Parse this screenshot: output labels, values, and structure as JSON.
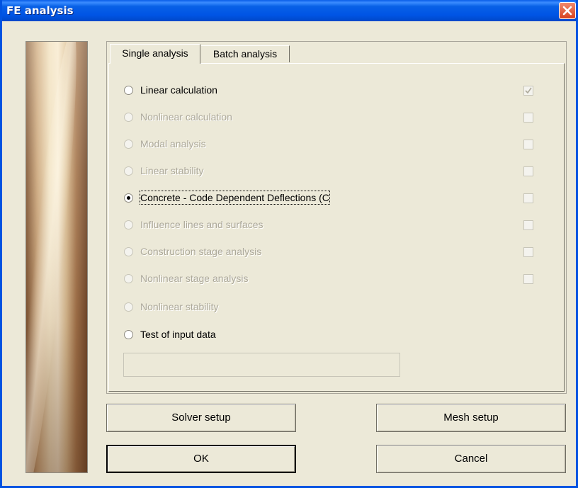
{
  "window": {
    "title": "FE analysis"
  },
  "tabs": [
    {
      "label": "Single analysis",
      "active": true
    },
    {
      "label": "Batch analysis",
      "active": false
    }
  ],
  "options": [
    {
      "label": "Linear calculation",
      "enabled": true,
      "selected": false,
      "checkbox": "checked"
    },
    {
      "label": "Nonlinear calculation",
      "enabled": false,
      "selected": false,
      "checkbox": "unchecked"
    },
    {
      "label": "Modal analysis",
      "enabled": false,
      "selected": false,
      "checkbox": "unchecked"
    },
    {
      "label": "Linear stability",
      "enabled": false,
      "selected": false,
      "checkbox": "unchecked"
    },
    {
      "label": "Concrete - Code Dependent Deflections (C",
      "enabled": true,
      "selected": true,
      "checkbox": "unchecked"
    },
    {
      "label": "Influence lines and surfaces",
      "enabled": false,
      "selected": false,
      "checkbox": "unchecked"
    },
    {
      "label": "Construction stage analysis",
      "enabled": false,
      "selected": false,
      "checkbox": "unchecked"
    },
    {
      "label": "Nonlinear stage analysis",
      "enabled": false,
      "selected": false,
      "checkbox": "unchecked"
    },
    {
      "label": "Nonlinear stability",
      "enabled": false,
      "selected": false,
      "checkbox": "none"
    },
    {
      "label": "Test of input data",
      "enabled": true,
      "selected": false,
      "checkbox": "none"
    }
  ],
  "test_field": {
    "value": ""
  },
  "buttons": {
    "solver_setup": "Solver setup",
    "mesh_setup": "Mesh setup",
    "ok": "OK",
    "cancel": "Cancel"
  },
  "colors": {
    "titlebar": "#0055e5",
    "dialog_bg": "#ece9d8",
    "disabled_text": "#aca899",
    "close_button": "#d8421e"
  },
  "icons": {
    "close": "close-icon",
    "check": "checkmark-icon"
  }
}
